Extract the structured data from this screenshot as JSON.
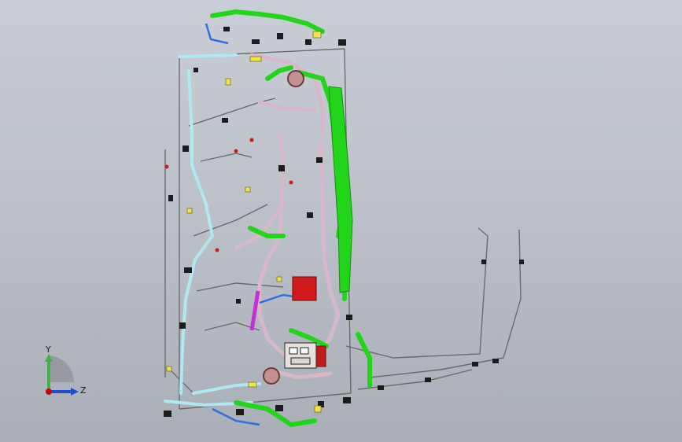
{
  "viewport": {
    "background_top": "#c9ced6",
    "background_bottom": "#a9aeb7"
  },
  "colors": {
    "harness_green": "#22d41a",
    "harness_pink": "#d7b8c6",
    "harness_cyan": "#aee9ef",
    "harness_blue": "#2f6fe0",
    "harness_gray": "#7f7f7f",
    "connector_black": "#1c1c1c",
    "connector_yellow": "#f3e44a",
    "connector_red": "#d11b1b",
    "connector_brown": "#b87a7a",
    "accent_magenta": "#c42fd6"
  },
  "triad": {
    "y_label": "Y",
    "z_label": "Z",
    "y_color": "#3fb24a",
    "z_color": "#1f4fd0",
    "origin_color": "#d10000",
    "icon": "coordinate-triad-icon"
  }
}
